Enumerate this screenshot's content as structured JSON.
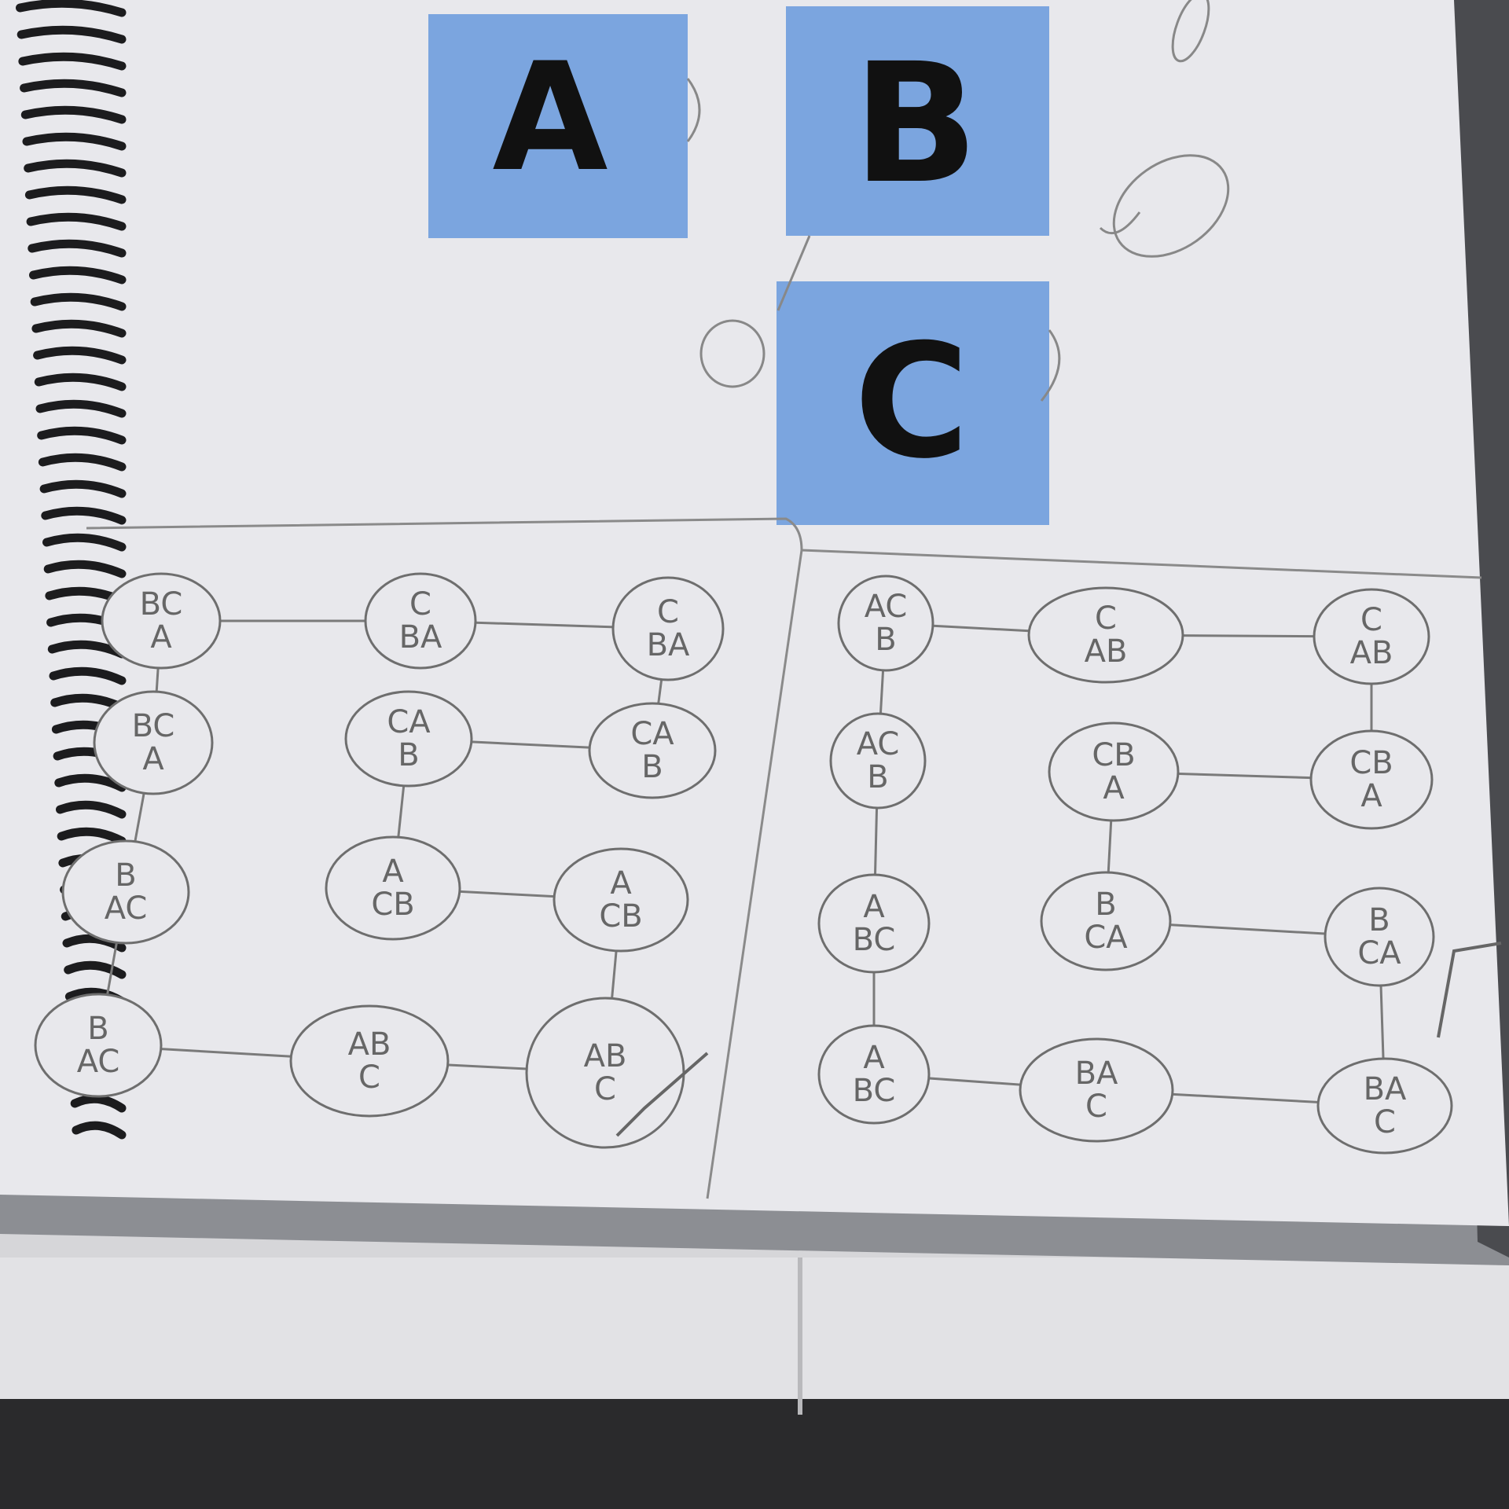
{
  "photo": {
    "subject": "notebook-page",
    "sticky_color": "#7ba5df",
    "paper_color": "#e8e8ec",
    "pencil_color": "#777777",
    "marker_color": "#111111"
  },
  "sticky_notes": [
    {
      "label": "A"
    },
    {
      "label": "B"
    },
    {
      "label": "C"
    }
  ],
  "left_diagram": {
    "nodes": [
      {
        "lines": [
          "BC",
          "A"
        ]
      },
      {
        "lines": [
          "C",
          "BA"
        ]
      },
      {
        "lines": [
          "C",
          "BA"
        ]
      },
      {
        "lines": [
          "BC",
          "A"
        ]
      },
      {
        "lines": [
          "CA",
          "B"
        ]
      },
      {
        "lines": [
          "CA",
          "B"
        ]
      },
      {
        "lines": [
          "B",
          "AC"
        ]
      },
      {
        "lines": [
          "A",
          "CB"
        ]
      },
      {
        "lines": [
          "A",
          "CB"
        ]
      },
      {
        "lines": [
          "B",
          "AC"
        ]
      },
      {
        "lines": [
          "AB",
          "C"
        ]
      },
      {
        "lines": [
          "AB",
          "C"
        ]
      }
    ]
  },
  "right_diagram": {
    "nodes": [
      {
        "lines": [
          "AC",
          "B"
        ]
      },
      {
        "lines": [
          "C",
          "AB"
        ]
      },
      {
        "lines": [
          "C",
          "AB"
        ]
      },
      {
        "lines": [
          "AC",
          "B"
        ]
      },
      {
        "lines": [
          "CB",
          "A"
        ]
      },
      {
        "lines": [
          "CB",
          "A"
        ]
      },
      {
        "lines": [
          "A",
          "BC"
        ]
      },
      {
        "lines": [
          "B",
          "CA"
        ]
      },
      {
        "lines": [
          "B",
          "CA"
        ]
      },
      {
        "lines": [
          "A",
          "BC"
        ]
      },
      {
        "lines": [
          "BA",
          "C"
        ]
      },
      {
        "lines": [
          "BA",
          "C"
        ]
      }
    ]
  }
}
